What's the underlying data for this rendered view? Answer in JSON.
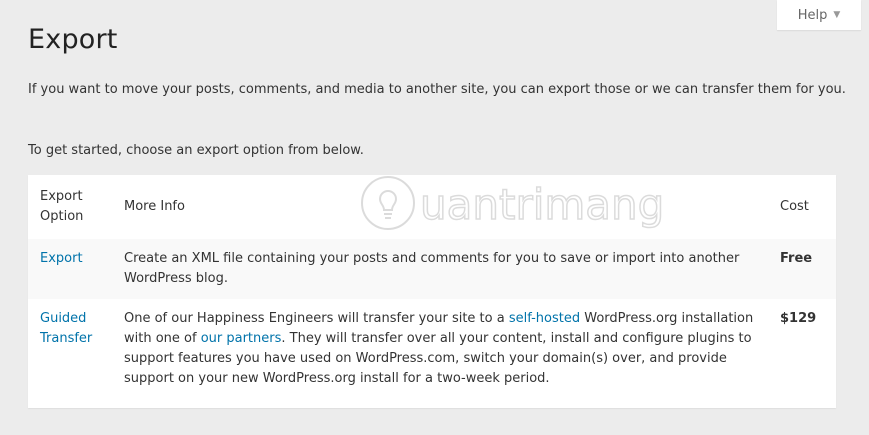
{
  "help": {
    "label": "Help",
    "caret": "▼"
  },
  "page": {
    "title": "Export",
    "intro": "If you want to move your posts, comments, and media to another site, you can export those or we can transfer them for you.",
    "intro2": "To get started, choose an export option from below."
  },
  "table": {
    "headers": {
      "option": "Export Option",
      "info": "More Info",
      "cost": "Cost"
    },
    "rows": [
      {
        "option": "Export",
        "info": "Create an XML file containing your posts and comments for you to save or import into another WordPress blog.",
        "cost": "Free"
      },
      {
        "option": "Guided Transfer",
        "info_parts": {
          "p1": "One of our Happiness Engineers will transfer your site to a ",
          "link1": "self-hosted",
          "p2": " WordPress.org installation with one of ",
          "link2": "our partners",
          "p3": ". They will transfer over all your content, install and configure plugins to support features you have used on WordPress.com, switch your domain(s) over, and provide support on your new WordPress.org install for a two-week period."
        },
        "cost": "$129"
      }
    ]
  },
  "colors": {
    "link": "#0073aa",
    "background": "#ececec",
    "panel": "#ffffff"
  },
  "watermark": {
    "text": "uantrimang",
    "icon": "lightbulb-icon"
  }
}
